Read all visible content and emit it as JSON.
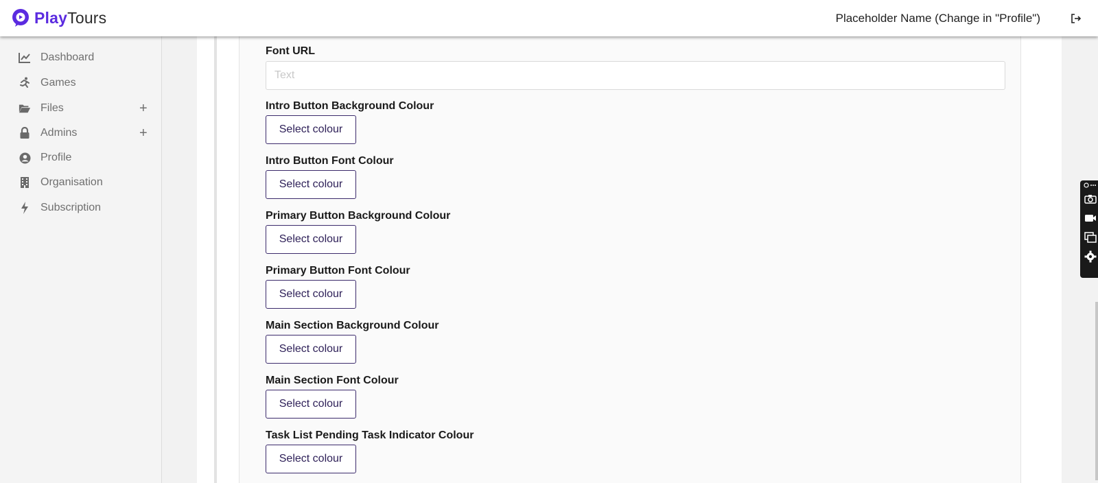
{
  "app": {
    "brand_play": "Play",
    "brand_tours": "Tours",
    "brand_color": "#5b2be0"
  },
  "header": {
    "user_name": "Placeholder Name (Change in \"Profile\")",
    "logout_icon": "logout-icon"
  },
  "sidebar": {
    "items": [
      {
        "label": "Dashboard",
        "icon": "chart-line-icon",
        "has_add": false
      },
      {
        "label": "Games",
        "icon": "running-person-icon",
        "has_add": false
      },
      {
        "label": "Files",
        "icon": "folder-open-icon",
        "has_add": true
      },
      {
        "label": "Admins",
        "icon": "lock-icon",
        "has_add": true
      },
      {
        "label": "Profile",
        "icon": "user-circle-icon",
        "has_add": false
      },
      {
        "label": "Organisation",
        "icon": "building-icon",
        "has_add": false
      },
      {
        "label": "Subscription",
        "icon": "bolt-icon",
        "has_add": false
      }
    ],
    "add_symbol": "+"
  },
  "form": {
    "font_url": {
      "label": "Font URL",
      "value": "",
      "placeholder": "Text"
    },
    "colour_fields": [
      {
        "label": "Intro Button Background Colour",
        "button": "Select colour"
      },
      {
        "label": "Intro Button Font Colour",
        "button": "Select colour"
      },
      {
        "label": "Primary Button Background Colour",
        "button": "Select colour"
      },
      {
        "label": "Primary Button Font Colour",
        "button": "Select colour"
      },
      {
        "label": "Main Section Background Colour",
        "button": "Select colour"
      },
      {
        "label": "Main Section Font Colour",
        "button": "Select colour"
      },
      {
        "label": "Task List Pending Task Indicator Colour",
        "button": "Select colour"
      }
    ]
  },
  "colors": {
    "accent": "#5b2be0",
    "button_border": "#3b2a6b",
    "button_text": "#2e2058",
    "sidebar_text": "#6f6f6f"
  }
}
